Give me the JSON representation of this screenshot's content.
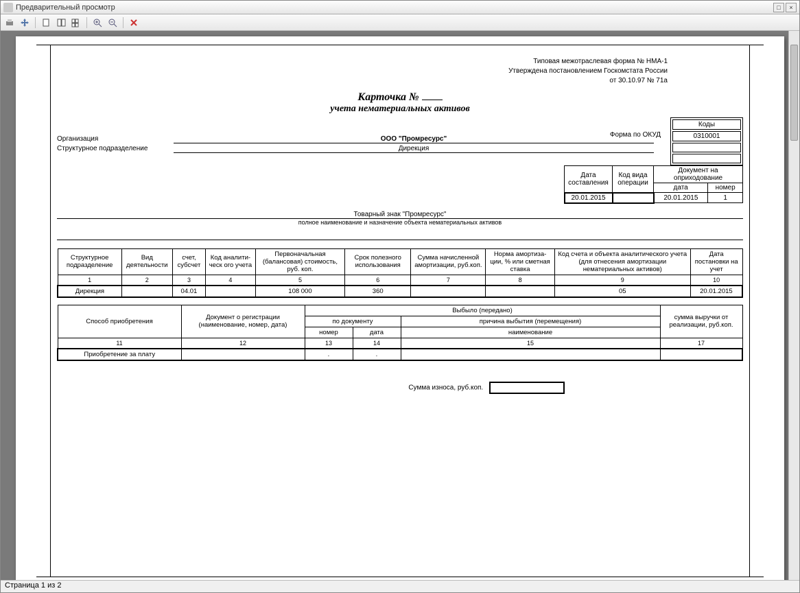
{
  "window": {
    "title": "Предварительный просмотр"
  },
  "toolbar": {
    "print": "print-icon",
    "move": "move-icon",
    "page1": "page-single-icon",
    "page2": "page-fit-icon",
    "page3": "page-multi-icon",
    "zoomin": "zoom-in-icon",
    "zoomout": "zoom-out-icon",
    "close": "close-icon"
  },
  "form_header": {
    "line1": "Типовая межотраслевая форма № НМА-1",
    "line2": "Утверждена постановлением Госкомстата России",
    "line3": "от 30.10.97 № 71а"
  },
  "title": {
    "line1_prefix": "Карточка  №",
    "line2": "учета нематериальных активов"
  },
  "codes": {
    "header": "Коды",
    "okud_label": "Форма по ОКУД",
    "okud": "0310001"
  },
  "org": {
    "org_label": "Организация",
    "org_value": "ООО \"Промресурс\"",
    "dept_label": "Структурное подразделение",
    "dept_value": "Дирекция"
  },
  "meta": {
    "date_hdr": "Дата составления",
    "opcode_hdr": "Код вида операции",
    "doc_hdr": "Документ на оприходование",
    "doc_date_hdr": "дата",
    "doc_num_hdr": "номер",
    "date_val": "20.01.2015",
    "opcode_val": "",
    "doc_date_val": "20.01.2015",
    "doc_num_val": "1"
  },
  "object": {
    "name": "Товарный знак \"Промресурс\"",
    "caption": "полное наименование и назначение объекта нематериальных активов"
  },
  "grid1": {
    "headers": [
      "Структурное подразделение",
      "Вид деятельности",
      "счет, субсчет",
      "Код аналити-ческ ого учета",
      "Первоначальная (балансовая) стоимость, руб. коп.",
      "Срок полезного использования",
      "Сумма начисленной амортизации, руб.коп.",
      "Норма амортиза-ции, % или сметная ставка",
      "Код счета и объекта аналитического учета (для отнесения амортизации нематериальных активов)",
      "Дата постановки на учет"
    ],
    "nums": [
      "1",
      "2",
      "3",
      "4",
      "5",
      "6",
      "7",
      "8",
      "9",
      "10"
    ],
    "row": [
      "Дирекция",
      "",
      "04.01",
      "",
      "108 000",
      "360",
      "",
      "",
      "05",
      "20.01.2015"
    ]
  },
  "grid2": {
    "h_acq": "Способ приобретения",
    "h_reg": "Документ о регистрации (наименование, номер, дата)",
    "h_disp": "Выбыло (передано)",
    "h_bydoc": "по документу",
    "h_reason": "причина выбытия (перемещения)",
    "h_num": "номер",
    "h_date": "дата",
    "h_name": "наименование",
    "h_sum": "сумма выручки от реализации, руб.коп.",
    "nums": [
      "11",
      "12",
      "13",
      "14",
      "15",
      "17"
    ],
    "row": [
      "Приобретение за плату",
      "",
      ".",
      ".",
      "",
      ""
    ]
  },
  "wear": {
    "label": "Сумма износа, руб.коп."
  },
  "status": {
    "text": "Страница 1 из 2"
  }
}
